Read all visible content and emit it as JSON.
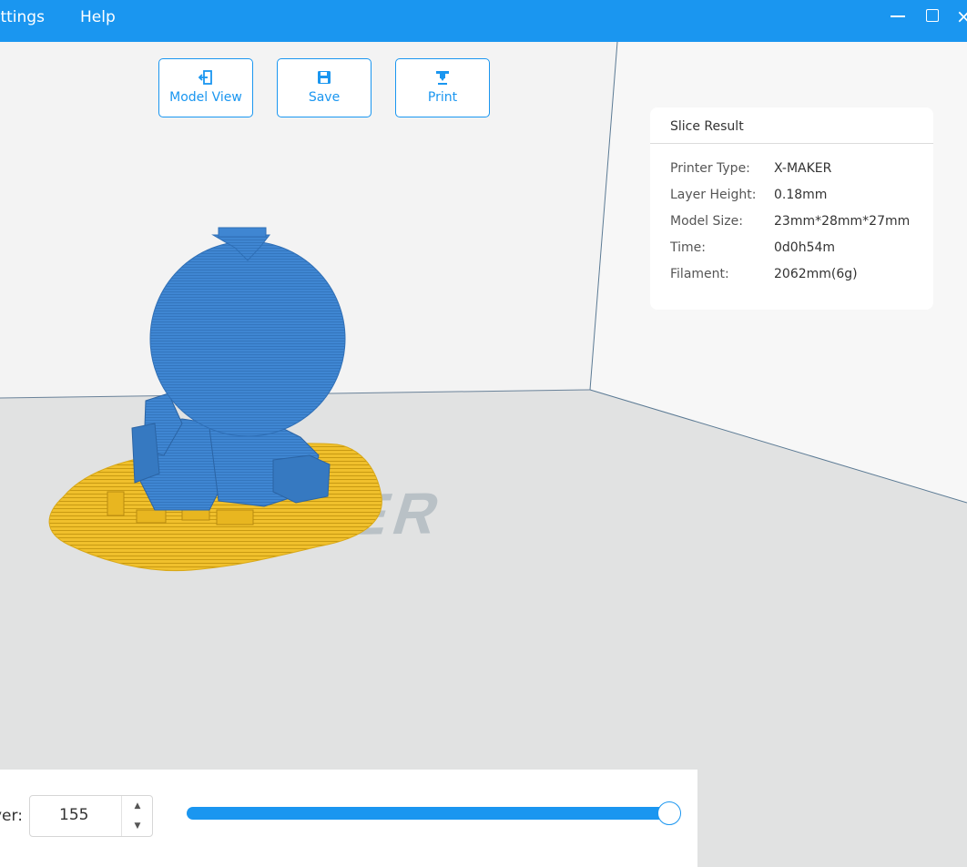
{
  "menu": {
    "settings": "ettings",
    "help": "Help"
  },
  "window": {
    "close_glyph": "×"
  },
  "toolbar": {
    "model_view": "Model View",
    "save": "Save",
    "print": "Print"
  },
  "scene": {
    "bed_logo_text": "X-MAKER",
    "model_color": "#3d84cf",
    "support_color": "#f2c230"
  },
  "slice_result": {
    "title": "Slice Result",
    "rows": [
      {
        "key": "Printer Type:",
        "value": "X-MAKER"
      },
      {
        "key": "Layer Height:",
        "value": "0.18mm"
      },
      {
        "key": "Model Size:",
        "value": "23mm*28mm*27mm"
      },
      {
        "key": "Time:",
        "value": "0d0h54m"
      },
      {
        "key": "Filament:",
        "value": "2062mm(6g)"
      }
    ]
  },
  "layer": {
    "label": "yer:",
    "value": "155",
    "slider_fraction": 1.0
  },
  "colors": {
    "accent": "#1a96f0"
  }
}
